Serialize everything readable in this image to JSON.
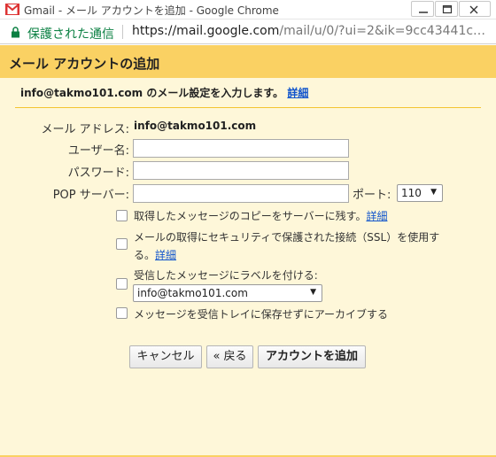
{
  "window": {
    "title": "Gmail - メール アカウントを追加 - Google Chrome"
  },
  "address_bar": {
    "secure_label": "保護された通信",
    "url_host": "https://mail.google.com",
    "url_path": "/mail/u/0/?ui=2&ik=9cc43441c…"
  },
  "dialog": {
    "title": "メール アカウントの追加",
    "intro_prefix": "info@takmo101.com のメール設定を入力します。",
    "intro_link": "詳細",
    "email_label": "メール アドレス:",
    "email_value": "info@takmo101.com",
    "username_label": "ユーザー名:",
    "username_value": "",
    "password_label": "パスワード:",
    "password_value": "",
    "pop_server_label": "POP サーバー:",
    "pop_server_value": "",
    "port_label": "ポート:",
    "port_value": "110",
    "options": {
      "leave_copy": {
        "label": "取得したメッセージのコピーをサーバーに残す。",
        "link": "詳細",
        "checked": false
      },
      "ssl": {
        "label_line1": "メールの取得にセキュリティで保護された接続（SSL）を使用す",
        "label_line2": "る。",
        "link": "詳細",
        "checked": false
      },
      "label_incoming": {
        "label": "受信したメッセージにラベルを付ける:",
        "checked": false,
        "selected_label": "info@takmo101.com"
      },
      "archive": {
        "label": "メッセージを受信トレイに保存せずにアーカイブする",
        "checked": false
      }
    },
    "buttons": {
      "cancel": "キャンセル",
      "back": "« 戻る",
      "add_account": "アカウントを追加"
    }
  },
  "colors": {
    "header_bg": "#fad163",
    "page_bg": "#fef7d9",
    "link": "#1155cc",
    "secure_green": "#0b8043"
  }
}
